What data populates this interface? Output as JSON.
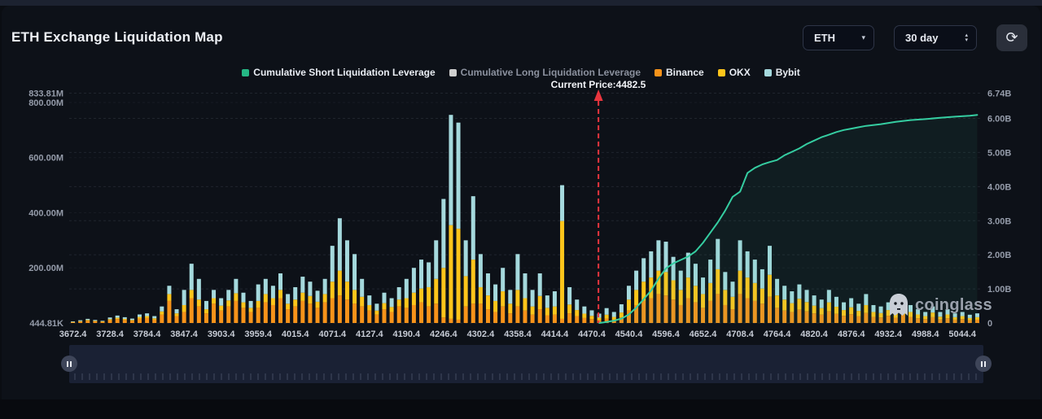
{
  "header": {
    "title": "ETH Exchange Liquidation Map",
    "symbol_value": "ETH",
    "range_value": "30 day",
    "glyphs": {
      "caret_down": "▾",
      "caret_up": "▴",
      "refresh": "⟳"
    }
  },
  "legend": {
    "items": [
      {
        "label": "Cumulative Short Liquidation Leverage",
        "color": "#25b885",
        "active": true
      },
      {
        "label": "Cumulative Long Liquidation Leverage",
        "color": "#cfcfcf",
        "active": false
      },
      {
        "label": "Binance",
        "color": "#f7931a",
        "active": true
      },
      {
        "label": "OKX",
        "color": "#ffc51b",
        "active": true
      },
      {
        "label": "Bybit",
        "color": "#a5d9dd",
        "active": true
      }
    ]
  },
  "current_price_label": "Current Price:4482.5",
  "watermark": "coinglass",
  "chart_data": {
    "type": "bar",
    "title": "ETH Exchange Liquidation Map",
    "current_price": 4482.5,
    "current_price_index": 70.9,
    "marker_color": "#e8353e",
    "grid": true,
    "legend_position": "top",
    "x_tick_labels": [
      "3672.4",
      "3728.4",
      "3784.4",
      "3847.4",
      "3903.4",
      "3959.4",
      "4015.4",
      "4071.4",
      "4127.4",
      "4190.4",
      "4246.4",
      "4302.4",
      "4358.4",
      "4414.4",
      "4470.4",
      "4540.4",
      "4596.4",
      "4652.4",
      "4708.4",
      "4764.4",
      "4820.4",
      "4876.4",
      "4932.4",
      "4988.4",
      "5044.4"
    ],
    "bars_per_tick": 5,
    "left_axis": {
      "unit": "M",
      "max_M": 833.81,
      "ticks": [
        {
          "label": "833.81M",
          "value_M": 833.81
        },
        {
          "label": "800.00M",
          "value_M": 800
        },
        {
          "label": "600.00M",
          "value_M": 600
        },
        {
          "label": "400.00M",
          "value_M": 400
        },
        {
          "label": "200.00M",
          "value_M": 200
        },
        {
          "label": "444.81K",
          "value_M": 0
        }
      ]
    },
    "right_axis": {
      "unit": "B",
      "max_B": 6.74,
      "ticks": [
        {
          "label": "6.74B",
          "value_B": 6.74
        },
        {
          "label": "6.00B",
          "value_B": 6
        },
        {
          "label": "5.00B",
          "value_B": 5
        },
        {
          "label": "4.00B",
          "value_B": 4
        },
        {
          "label": "3.00B",
          "value_B": 3
        },
        {
          "label": "2.00B",
          "value_B": 2
        },
        {
          "label": "1.00B",
          "value_B": 1
        },
        {
          "label": "0",
          "value_B": 0
        }
      ]
    },
    "series": [
      {
        "name": "Binance",
        "type": "bar",
        "color": "#f7931a",
        "unit": "M",
        "values": [
          3,
          5,
          8,
          6,
          4,
          10,
          14,
          11,
          8,
          16,
          18,
          12,
          30,
          80,
          25,
          40,
          90,
          60,
          35,
          70,
          45,
          60,
          80,
          55,
          40,
          55,
          75,
          65,
          90,
          50,
          60,
          80,
          70,
          55,
          75,
          90,
          100,
          85,
          70,
          60,
          45,
          30,
          50,
          40,
          60,
          55,
          65,
          75,
          60,
          70,
          20,
          15,
          12,
          60,
          70,
          70,
          50,
          40,
          60,
          35,
          60,
          45,
          30,
          50,
          28,
          30,
          15,
          35,
          25,
          18,
          14,
          10,
          16,
          12,
          20,
          45,
          65,
          80,
          90,
          105,
          100,
          85,
          65,
          90,
          75,
          55,
          80,
          105,
          65,
          50,
          105,
          90,
          80,
          70,
          95,
          55,
          45,
          40,
          48,
          42,
          35,
          30,
          42,
          33,
          26,
          32,
          24,
          36,
          22,
          20,
          26,
          19,
          30,
          22,
          17,
          14,
          21,
          13,
          17,
          12,
          14,
          10,
          12
        ]
      },
      {
        "name": "OKX",
        "type": "bar",
        "color": "#ffc51b",
        "unit": "M",
        "values": [
          1,
          2,
          3,
          2,
          2,
          4,
          5,
          4,
          3,
          6,
          7,
          5,
          12,
          25,
          10,
          25,
          30,
          25,
          15,
          20,
          18,
          22,
          28,
          20,
          15,
          25,
          30,
          25,
          30,
          20,
          25,
          30,
          28,
          22,
          30,
          60,
          90,
          65,
          50,
          35,
          20,
          15,
          22,
          18,
          25,
          35,
          45,
          50,
          70,
          90,
          180,
          340,
          330,
          110,
          160,
          60,
          50,
          40,
          55,
          35,
          60,
          45,
          30,
          48,
          27,
          30,
          355,
          32,
          22,
          16,
          12,
          9,
          14,
          10,
          18,
          40,
          55,
          70,
          75,
          85,
          85,
          70,
          55,
          75,
          60,
          50,
          65,
          90,
          55,
          45,
          85,
          75,
          65,
          55,
          80,
          45,
          40,
          32,
          40,
          34,
          28,
          24,
          33,
          26,
          21,
          25,
          20,
          29,
          18,
          16,
          21,
          15,
          24,
          18,
          14,
          11,
          17,
          10,
          14,
          9,
          11,
          8,
          9
        ]
      },
      {
        "name": "Bybit",
        "type": "bar",
        "color": "#a5d9dd",
        "unit": "M",
        "values": [
          2,
          3,
          4,
          3,
          2,
          6,
          8,
          6,
          5,
          9,
          10,
          8,
          18,
          30,
          15,
          55,
          95,
          75,
          30,
          30,
          27,
          38,
          52,
          35,
          25,
          60,
          55,
          45,
          60,
          35,
          45,
          58,
          52,
          40,
          55,
          130,
          190,
          150,
          130,
          65,
          35,
          25,
          38,
          32,
          45,
          70,
          90,
          105,
          90,
          140,
          250,
          400,
          385,
          130,
          230,
          120,
          80,
          60,
          85,
          50,
          130,
          90,
          60,
          82,
          45,
          55,
          130,
          63,
          38,
          26,
          20,
          15,
          24,
          18,
          30,
          50,
          70,
          85,
          95,
          110,
          110,
          85,
          70,
          90,
          80,
          60,
          85,
          110,
          65,
          55,
          110,
          95,
          85,
          70,
          105,
          60,
          50,
          43,
          52,
          44,
          37,
          31,
          45,
          36,
          28,
          33,
          26,
          40,
          25,
          24,
          28,
          21,
          31,
          25,
          19,
          15,
          22,
          17,
          19,
          14,
          15,
          12,
          14
        ]
      },
      {
        "name": "Cumulative Short Liquidation Leverage",
        "type": "line",
        "color": "#35cda1",
        "unit": "B",
        "points": [
          [
            71,
            0
          ],
          [
            72,
            0.03
          ],
          [
            73,
            0.07
          ],
          [
            74,
            0.13
          ],
          [
            75,
            0.25
          ],
          [
            76,
            0.45
          ],
          [
            77,
            0.7
          ],
          [
            78,
            0.95
          ],
          [
            79,
            1.3
          ],
          [
            80,
            1.6
          ],
          [
            81,
            1.75
          ],
          [
            82,
            1.85
          ],
          [
            83,
            1.95
          ],
          [
            84,
            2.1
          ],
          [
            85,
            2.35
          ],
          [
            86,
            2.65
          ],
          [
            87,
            2.95
          ],
          [
            88,
            3.3
          ],
          [
            89,
            3.7
          ],
          [
            90,
            3.85
          ],
          [
            91,
            4.4
          ],
          [
            92,
            4.55
          ],
          [
            93,
            4.65
          ],
          [
            94,
            4.72
          ],
          [
            95,
            4.78
          ],
          [
            96,
            4.92
          ],
          [
            97,
            5.02
          ],
          [
            98,
            5.12
          ],
          [
            99,
            5.25
          ],
          [
            100,
            5.35
          ],
          [
            101,
            5.45
          ],
          [
            102,
            5.52
          ],
          [
            103,
            5.6
          ],
          [
            104,
            5.66
          ],
          [
            105,
            5.7
          ],
          [
            106,
            5.74
          ],
          [
            107,
            5.78
          ],
          [
            109,
            5.83
          ],
          [
            111,
            5.9
          ],
          [
            113,
            5.95
          ],
          [
            115,
            5.98
          ],
          [
            117,
            6.02
          ],
          [
            119,
            6.05
          ],
          [
            121,
            6.08
          ],
          [
            122,
            6.1
          ]
        ]
      },
      {
        "name": "Cumulative Long Liquidation Leverage",
        "type": "line",
        "color": "#cfcfcf",
        "unit": "B",
        "points": []
      }
    ]
  }
}
